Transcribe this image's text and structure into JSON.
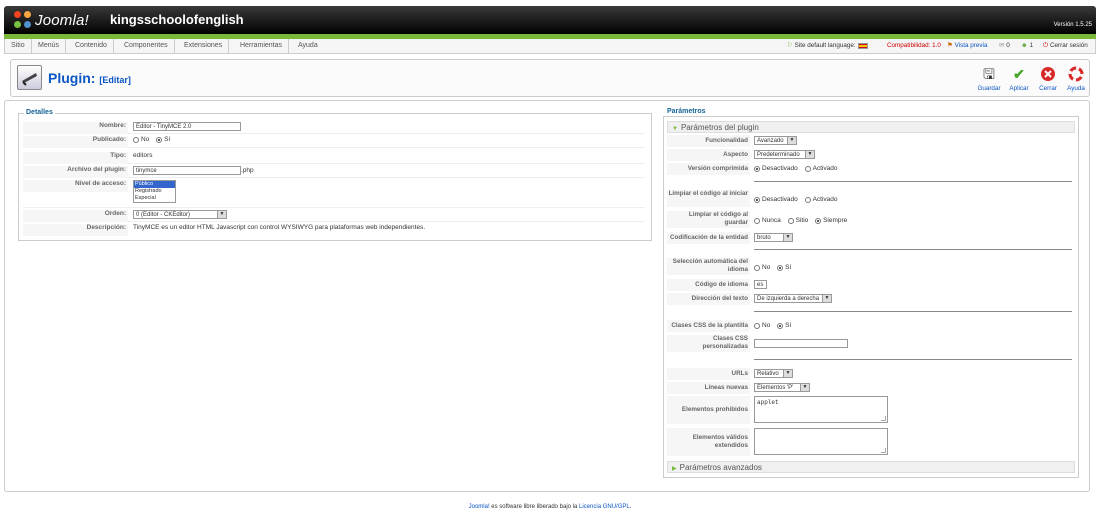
{
  "header": {
    "logo_text": "Joomla!",
    "site_name": "kingsschoolofenglish",
    "version": "Versión 1.5.25"
  },
  "menu": {
    "items": [
      "Sitio",
      "Menús",
      "Contenido",
      "Componentes",
      "Extensiones",
      "Herramientas",
      "Ayuda"
    ]
  },
  "status": {
    "site_language": "Site default language:",
    "compat": "Compatibilidad: 1.0",
    "preview": "Vista previa",
    "messages": "0",
    "users": "1",
    "logout": "Cerrar sesión"
  },
  "toolbar": {
    "title": "Plugin:",
    "subtitle": "[Editar]",
    "save": "Guardar",
    "apply": "Aplicar",
    "close": "Cerrar",
    "help": "Ayuda"
  },
  "details": {
    "legend": "Detalles",
    "name_label": "Nombre:",
    "name_value": "Editor - TinyMCE 2.0",
    "published_label": "Publicado:",
    "published_no": "No",
    "published_yes": "Sí",
    "type_label": "Tipo:",
    "type_value": "editors",
    "file_label": "Archivo del plugin:",
    "file_value": "tinymce",
    "file_ext": ".php",
    "access_label": "Nivel de acceso:",
    "access_options": [
      "Público",
      "Registrado",
      "Especial"
    ],
    "order_label": "Orden:",
    "order_value": "0 (Editor - CKEditor)",
    "desc_label": "Descripción:",
    "desc_value": "TinyMCE es un editor HTML Javascript con control WYSIWYG para plataformas web independientes."
  },
  "params": {
    "title": "Parámetros",
    "plugin_section": "Parámetros del plugin",
    "advanced_section": "Parámetros avanzados",
    "funcionalidad_label": "Funcionalidad",
    "funcionalidad_value": "Avanzado",
    "aspecto_label": "Aspecto",
    "aspecto_value": "Predeterminado",
    "version_label": "Versión comprimida",
    "desactivado": "Desactivado",
    "activado": "Activado",
    "limpiar_label": "Limpiar el código al iniciar",
    "limpiar_guardar_label": "Limpiar el código al guardar",
    "nunca": "Nunca",
    "sitio": "Sitio",
    "siempre": "Siempre",
    "codif_label": "Codificación de la entidad",
    "codif_value": "bruto",
    "seleccion_label": "Selección automática del idioma",
    "no": "No",
    "si": "Sí",
    "codigo_label": "Código de idioma",
    "codigo_value": "es",
    "direccion_label": "Dirección del texto",
    "direccion_value": "De izquierda a derecha",
    "clases_label": "Clases CSS de la plantilla",
    "clases_pers_label": "Clases CSS personalizadas",
    "urls_label": "URLs",
    "urls_value": "Relativo",
    "lineas_label": "Líneas nuevas",
    "lineas_value": "Elementos 'P'",
    "prohibidos_label": "Elementos prohibidos",
    "prohibidos_value": "applet",
    "validos_label": "Elementos válidos extendidos"
  },
  "footer": {
    "joomla": "Joomla!",
    "text": " es software libre liberado bajo la ",
    "license": "Licencia GNU/GPL",
    "end": "."
  }
}
